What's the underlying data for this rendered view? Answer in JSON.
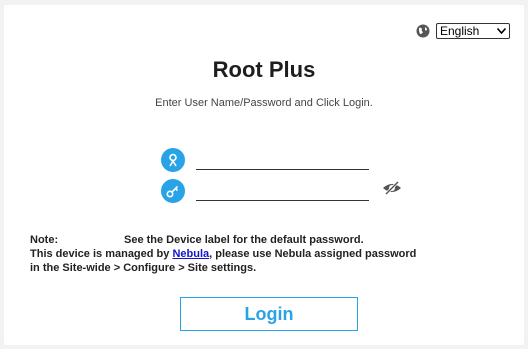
{
  "language": {
    "selected": "English"
  },
  "title": "Root Plus",
  "subtitle": "Enter User Name/Password and Click Login.",
  "username": {
    "value": "",
    "placeholder": ""
  },
  "password": {
    "value": "",
    "placeholder": ""
  },
  "note": {
    "label": "Note:",
    "line1": "See the Device label for the default password.",
    "line2_prefix": "This device is managed by ",
    "line2_link": "Nebula",
    "line2_suffix": ", please use Nebula assigned password",
    "line3": "in the Site-wide > Configure > Site settings."
  },
  "login_label": "Login",
  "icons": {
    "globe": "globe-icon",
    "user": "user-icon",
    "password": "key-icon",
    "toggle": "eye-slash-icon"
  },
  "colors": {
    "accent": "#29a3e8",
    "link": "#1515c8",
    "background": "#f2f2f2"
  }
}
